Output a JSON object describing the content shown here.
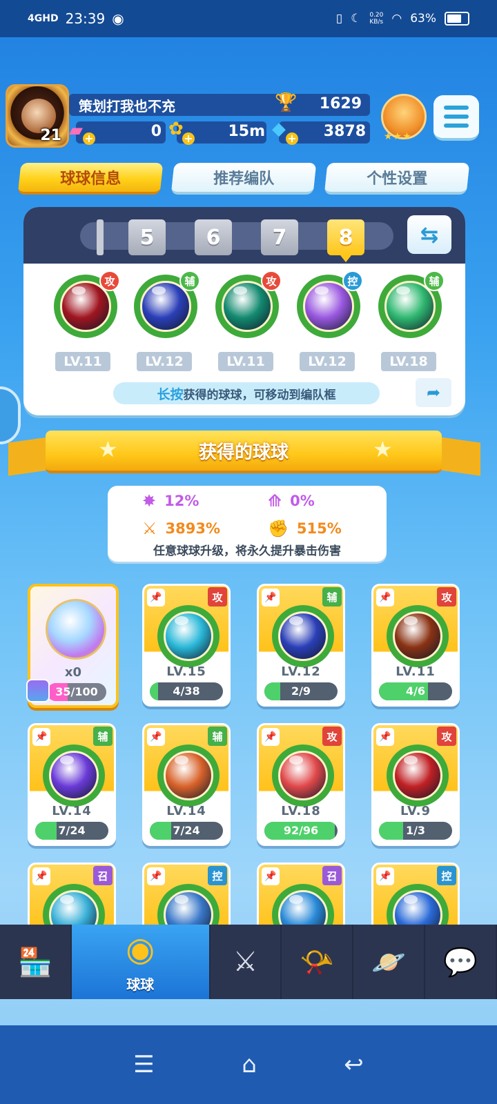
{
  "status_bar": {
    "network": "4GHD",
    "time": "23:39",
    "speed_value": "0.20",
    "speed_unit": "KB/s",
    "battery": "63%"
  },
  "profile": {
    "player_name": "策划打我也不充",
    "avatar_level": "21",
    "trophies": "1629",
    "tickets": "0",
    "coins": "15m",
    "gems": "3878"
  },
  "tabs": [
    {
      "label": "球球信息",
      "active": true
    },
    {
      "label": "推荐编队",
      "active": false
    },
    {
      "label": "个性设置",
      "active": false
    }
  ],
  "team": {
    "slots": [
      "5",
      "6",
      "7",
      "8"
    ],
    "active_slot": "8",
    "balls": [
      {
        "level": "LV.11",
        "role": "攻",
        "color": "#a01520"
      },
      {
        "level": "LV.12",
        "role": "辅",
        "color": "#2b3fb8"
      },
      {
        "level": "LV.11",
        "role": "攻",
        "color": "#138a70"
      },
      {
        "level": "LV.12",
        "role": "控",
        "color": "#9a58e0"
      },
      {
        "level": "LV.18",
        "role": "辅",
        "color": "#2fb870"
      }
    ],
    "hint_highlight": "长按",
    "hint_rest": "获得的球球，可移动到编队框"
  },
  "collection": {
    "title": "获得的球球",
    "crit": {
      "stat1": "12%",
      "stat2": "0%",
      "stat3": "3893%",
      "stat4": "515%",
      "note": "任意球球升级，将永久提升暴击伤害"
    },
    "special": {
      "count": "x0",
      "progress": "35/100",
      "fill_ratio": 0.35
    },
    "cards": [
      {
        "level": "LV.15",
        "progress": "4/38",
        "fill_ratio": 0.11,
        "role": "攻",
        "color": "#2ab8d8"
      },
      {
        "level": "LV.12",
        "progress": "2/9",
        "fill_ratio": 0.22,
        "role": "辅",
        "color": "#2b3fb8"
      },
      {
        "level": "LV.11",
        "progress": "4/6",
        "fill_ratio": 0.67,
        "role": "攻",
        "color": "#8a3214"
      },
      {
        "level": "LV.14",
        "progress": "7/24",
        "fill_ratio": 0.29,
        "role": "辅",
        "color": "#6a3ad8"
      },
      {
        "level": "LV.14",
        "progress": "7/24",
        "fill_ratio": 0.29,
        "role": "辅",
        "color": "#d8622a"
      },
      {
        "level": "LV.18",
        "progress": "92/96",
        "fill_ratio": 0.96,
        "role": "攻",
        "color": "#e0484a"
      },
      {
        "level": "LV.9",
        "progress": "1/3",
        "fill_ratio": 0.33,
        "role": "攻",
        "color": "#c02024"
      },
      {
        "level": "",
        "progress": "",
        "fill_ratio": 0,
        "role": "召",
        "color": "#3ab0d8"
      },
      {
        "level": "",
        "progress": "",
        "fill_ratio": 0,
        "role": "控",
        "color": "#3a78c8"
      },
      {
        "level": "",
        "progress": "",
        "fill_ratio": 0,
        "role": "召",
        "color": "#2a8ad8"
      },
      {
        "level": "",
        "progress": "",
        "fill_ratio": 0,
        "role": "控",
        "color": "#2a6ad8"
      }
    ]
  },
  "bottom_nav": {
    "items": [
      {
        "name": "shop",
        "icon": "shop-icon"
      },
      {
        "name": "balls",
        "icon": "balls-icon",
        "label": "球球",
        "active": true
      },
      {
        "name": "battle",
        "icon": "crossed-swords-icon"
      },
      {
        "name": "whistle",
        "icon": "whistle-icon"
      },
      {
        "name": "planet",
        "icon": "planet-icon"
      },
      {
        "name": "social",
        "icon": "chat-heart-icon"
      }
    ]
  }
}
